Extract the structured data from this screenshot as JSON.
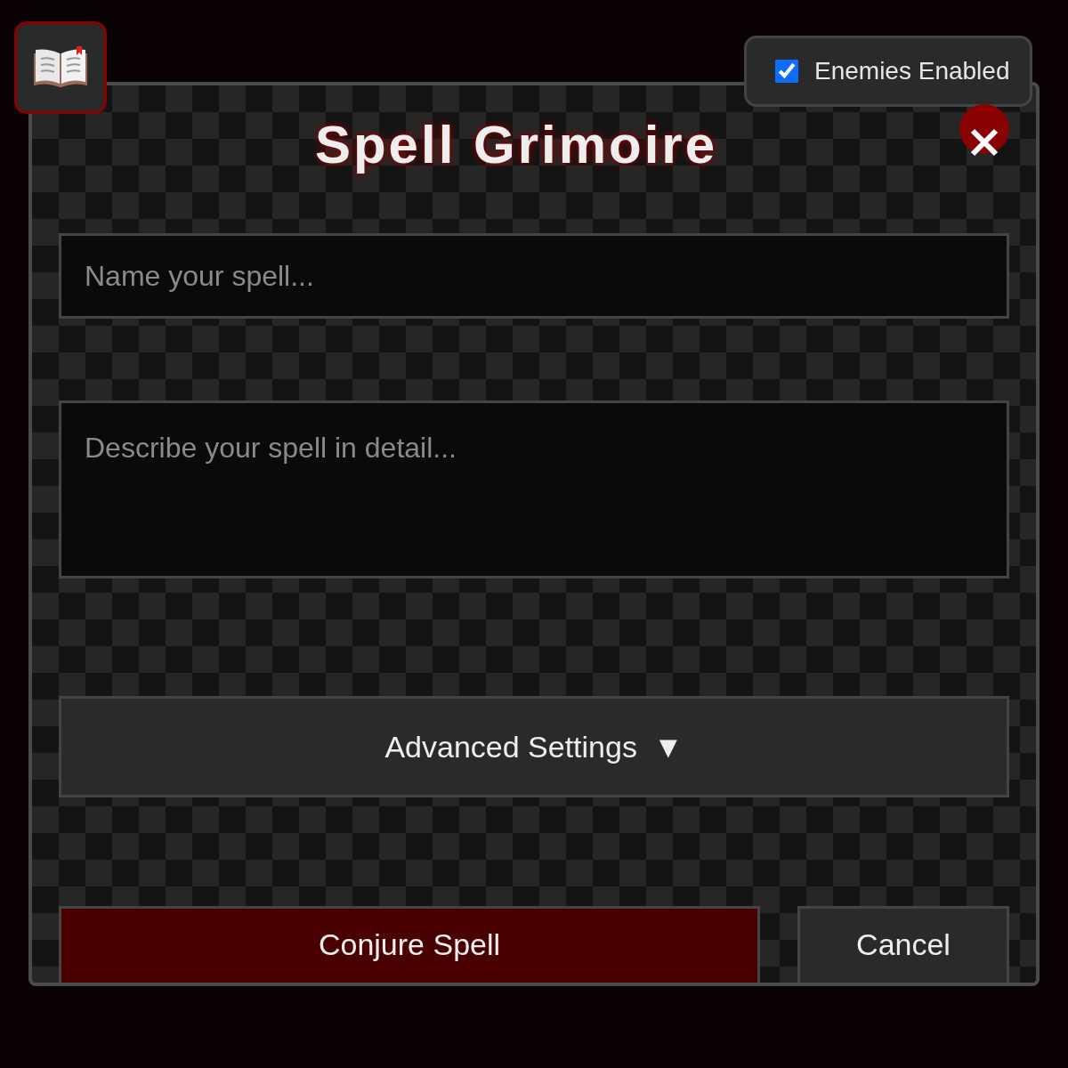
{
  "toggle": {
    "label": "Enemies Enabled",
    "checked": true
  },
  "dialog": {
    "title": "Spell Grimoire"
  },
  "name_field": {
    "placeholder": "Name your spell..."
  },
  "description_field": {
    "placeholder": "Describe your spell in detail..."
  },
  "advanced": {
    "label": "Advanced Settings",
    "caret": "▼"
  },
  "buttons": [
    {
      "label": "Conjure Spell",
      "kind": "primary"
    },
    {
      "label": "Cancel",
      "kind": "secondary"
    }
  ]
}
